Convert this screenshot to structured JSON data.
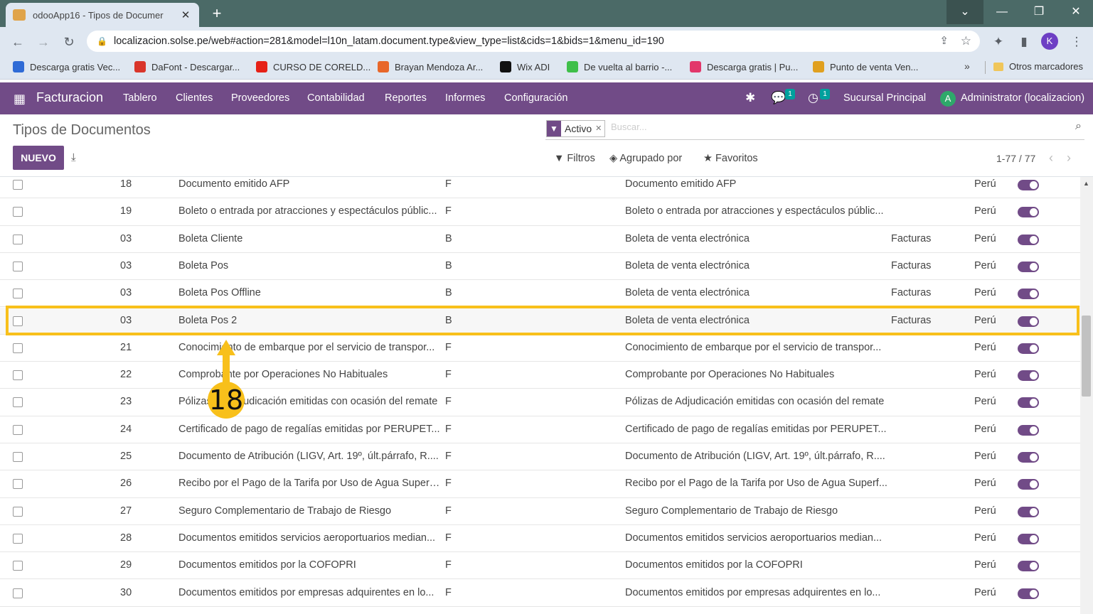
{
  "browser": {
    "tab_title": "odooApp16 - Tipos de Documer",
    "url": "localizacion.solse.pe/web#action=281&model=l10n_latam.document.type&view_type=list&cids=1&bids=1&menu_id=190",
    "profile_initial": "K",
    "bookmarks": [
      {
        "label": "Descarga gratis Vec...",
        "color": "#2f6bd6"
      },
      {
        "label": "DaFont - Descargar...",
        "color": "#d9352b"
      },
      {
        "label": "CURSO DE CORELD...",
        "color": "#e62117"
      },
      {
        "label": "Brayan Mendoza Ar...",
        "color": "#e8672a"
      },
      {
        "label": "Wix ADI",
        "color": "#111111"
      },
      {
        "label": "De vuelta al barrio -...",
        "color": "#3fbf4a"
      },
      {
        "label": "Descarga gratis | Pu...",
        "color": "#e2376b"
      },
      {
        "label": "Punto de venta Ven...",
        "color": "#e0a020"
      }
    ],
    "bookmarks_more": "»",
    "other_bookmarks": "Otros marcadores"
  },
  "navbar": {
    "app_name": "Facturacion",
    "menu": [
      "Tablero",
      "Clientes",
      "Proveedores",
      "Contabilidad",
      "Reportes",
      "Informes",
      "Configuración"
    ],
    "messages_badge": "1",
    "activities_badge": "1",
    "company": "Sucursal Principal",
    "user_initial": "A",
    "user": "Administrator (localizacion)"
  },
  "control_panel": {
    "breadcrumb": "Tipos de Documentos",
    "new_button": "NUEVO",
    "facet": "Activo",
    "search_placeholder": "Buscar...",
    "filters": "Filtros",
    "group_by": "Agrupado por",
    "favorites": "Favoritos",
    "pager": "1-77 / 77"
  },
  "rows": [
    {
      "code": "18",
      "name": "Documento emitido AFP",
      "letter": "F",
      "report_name": "Documento emitido AFP",
      "journal": "",
      "country": "Perú",
      "active": true
    },
    {
      "code": "19",
      "name": "Boleto o entrada por atracciones y espectáculos públic...",
      "letter": "F",
      "report_name": "Boleto o entrada por atracciones y espectáculos públic...",
      "journal": "",
      "country": "Perú",
      "active": true
    },
    {
      "code": "03",
      "name": "Boleta Cliente",
      "letter": "B",
      "report_name": "Boleta de venta electrónica",
      "journal": "Facturas",
      "country": "Perú",
      "active": true
    },
    {
      "code": "03",
      "name": "Boleta Pos",
      "letter": "B",
      "report_name": "Boleta de venta electrónica",
      "journal": "Facturas",
      "country": "Perú",
      "active": true
    },
    {
      "code": "03",
      "name": "Boleta Pos Offline",
      "letter": "B",
      "report_name": "Boleta de venta electrónica",
      "journal": "Facturas",
      "country": "Perú",
      "active": true
    },
    {
      "code": "03",
      "name": "Boleta Pos 2",
      "letter": "B",
      "report_name": "Boleta de venta electrónica",
      "journal": "Facturas",
      "country": "Perú",
      "active": true
    },
    {
      "code": "21",
      "name": "Conocimiento de embarque por el servicio de transpor...",
      "letter": "F",
      "report_name": "Conocimiento de embarque por el servicio de transpor...",
      "journal": "",
      "country": "Perú",
      "active": true
    },
    {
      "code": "22",
      "name": "Comprobante por Operaciones No Habituales",
      "letter": "F",
      "report_name": "Comprobante por Operaciones No Habituales",
      "journal": "",
      "country": "Perú",
      "active": true
    },
    {
      "code": "23",
      "name": "Pólizas de Adjudicación emitidas con ocasión del remate",
      "letter": "F",
      "report_name": "Pólizas de Adjudicación emitidas con ocasión del remate",
      "journal": "",
      "country": "Perú",
      "active": true
    },
    {
      "code": "24",
      "name": "Certificado de pago de regalías emitidas por PERUPET...",
      "letter": "F",
      "report_name": "Certificado de pago de regalías emitidas por PERUPET...",
      "journal": "",
      "country": "Perú",
      "active": true
    },
    {
      "code": "25",
      "name": "Documento de Atribución (LIGV, Art. 19º, últ.párrafo, R....",
      "letter": "F",
      "report_name": "Documento de Atribución (LIGV, Art. 19º, últ.párrafo, R....",
      "journal": "",
      "country": "Perú",
      "active": true
    },
    {
      "code": "26",
      "name": "Recibo por el Pago de la Tarifa por Uso de Agua Superf...",
      "letter": "F",
      "report_name": "Recibo por el Pago de la Tarifa por Uso de Agua Superf...",
      "journal": "",
      "country": "Perú",
      "active": true
    },
    {
      "code": "27",
      "name": "Seguro Complementario de Trabajo de Riesgo",
      "letter": "F",
      "report_name": "Seguro Complementario de Trabajo de Riesgo",
      "journal": "",
      "country": "Perú",
      "active": true
    },
    {
      "code": "28",
      "name": "Documentos emitidos servicios aeroportuarios median...",
      "letter": "F",
      "report_name": "Documentos emitidos servicios aeroportuarios median...",
      "journal": "",
      "country": "Perú",
      "active": true
    },
    {
      "code": "29",
      "name": "Documentos emitidos por la COFOPRI",
      "letter": "F",
      "report_name": "Documentos emitidos por la COFOPRI",
      "journal": "",
      "country": "Perú",
      "active": true
    },
    {
      "code": "30",
      "name": "Documentos emitidos por empresas adquirentes en lo...",
      "letter": "F",
      "report_name": "Documentos emitidos por empresas adquirentes en lo...",
      "journal": "",
      "country": "Perú",
      "active": true
    }
  ],
  "annotation": {
    "step": "18",
    "color": "#f8c01b"
  },
  "colors": {
    "brand": "#714b87",
    "highlight": "#f8c01b"
  }
}
